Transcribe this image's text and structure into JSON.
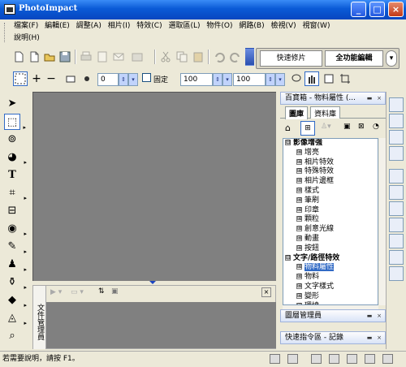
{
  "title": "PhotoImpact",
  "window_buttons": {
    "min": "_",
    "max": "□",
    "close": "×"
  },
  "menu": [
    "檔案(F)",
    "編輯(E)",
    "調整(A)",
    "相片(I)",
    "特效(C)",
    "選取區(L)",
    "物件(O)",
    "網路(B)",
    "檢視(V)",
    "視窗(W)",
    "說明(H)"
  ],
  "modes": {
    "quick": "快速修片",
    "full": "全功能編輯"
  },
  "attr_bar": {
    "value1": "0",
    "fixed_label": "固定",
    "width": "100",
    "height": "100"
  },
  "panel": {
    "title": "百寶箱 - 物料屬性 (...",
    "tabs": [
      "圖庫",
      "資料庫"
    ],
    "tree": [
      {
        "label": "影像增強",
        "expander": "⊟",
        "level": 0,
        "bold": true
      },
      {
        "label": "增亮",
        "expander": "⊞",
        "level": 1
      },
      {
        "label": "相片特效",
        "expander": "⊞",
        "level": 1
      },
      {
        "label": "特殊特效",
        "expander": "⊞",
        "level": 1
      },
      {
        "label": "相片邊框",
        "expander": "⊞",
        "level": 1
      },
      {
        "label": "樣式",
        "expander": "⊞",
        "level": 1
      },
      {
        "label": "筆刷",
        "expander": "⊞",
        "level": 1
      },
      {
        "label": "印章",
        "expander": "⊞",
        "level": 1
      },
      {
        "label": "顆粒",
        "expander": "⊞",
        "level": 1
      },
      {
        "label": "創意光線",
        "expander": "⊞",
        "level": 1
      },
      {
        "label": "動畫",
        "expander": "⊞",
        "level": 1
      },
      {
        "label": "按鈕",
        "expander": "⊞",
        "level": 1
      },
      {
        "label": "文字/路徑特效",
        "expander": "⊟",
        "level": 0,
        "bold": true
      },
      {
        "label": "物料屬性",
        "expander": "⊞",
        "level": 1,
        "selected": true
      },
      {
        "label": "物料",
        "expander": "⊞",
        "level": 1
      },
      {
        "label": "文字樣式",
        "expander": "⊞",
        "level": 1
      },
      {
        "label": "變形",
        "expander": "⊞",
        "level": 1
      },
      {
        "label": "環繞",
        "expander": "⊞",
        "level": 1
      }
    ]
  },
  "layer_manager": "圖層管理員",
  "quick_cmd": "快速指令區 - 記錄",
  "doc_manager": "文件管理員",
  "status": "若需要說明，請按 F1。",
  "colors": {
    "titlebar": "#0a5ad6",
    "selection": "#316ac5",
    "canvas": "#808080"
  }
}
